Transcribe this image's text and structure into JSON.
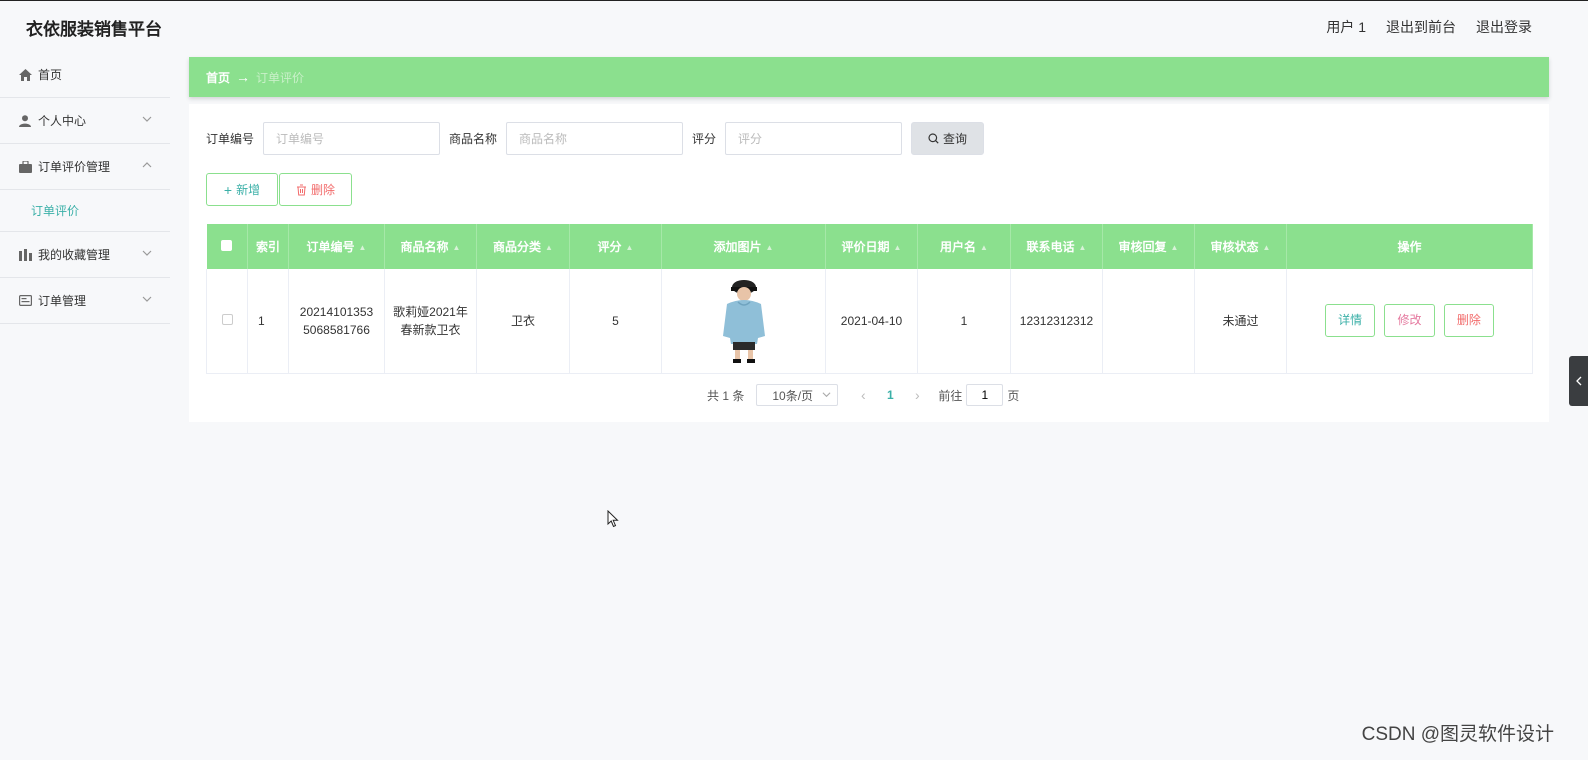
{
  "header": {
    "title": "衣依服装销售平台",
    "user": "用户 1",
    "to_front": "退出到前台",
    "logout": "退出登录"
  },
  "sidebar": {
    "items": [
      {
        "label": "首页",
        "icon": "home-icon"
      },
      {
        "label": "个人中心",
        "icon": "user-icon"
      },
      {
        "label": "订单评价管理",
        "icon": "briefcase-icon"
      },
      {
        "label": "我的收藏管理",
        "icon": "chart-icon"
      },
      {
        "label": "订单管理",
        "icon": "card-icon"
      }
    ],
    "submenu": {
      "label": "订单评价"
    }
  },
  "breadcrumb": {
    "home": "首页",
    "arrow": "→",
    "current": "订单评价"
  },
  "search": {
    "order_no_label": "订单编号",
    "order_no_placeholder": "订单编号",
    "product_label": "商品名称",
    "product_placeholder": "商品名称",
    "score_label": "评分",
    "score_placeholder": "评分",
    "query_label": "查询"
  },
  "actions": {
    "add_label": "新增",
    "delete_label": "删除"
  },
  "table": {
    "columns": [
      "索引",
      "订单编号",
      "商品名称",
      "商品分类",
      "评分",
      "添加图片",
      "评价日期",
      "用户名",
      "联系电话",
      "审核回复",
      "审核状态",
      "操作"
    ],
    "rows": [
      {
        "index": "1",
        "order_no": "202141013535068581766",
        "product": "歌莉娅2021年春新款卫衣",
        "category": "卫衣",
        "score": "5",
        "date": "2021-04-10",
        "username": "1",
        "phone": "12312312312",
        "reply": "",
        "status": "未通过"
      }
    ],
    "row_actions": {
      "detail": "详情",
      "edit": "修改",
      "delete": "删除"
    }
  },
  "pagination": {
    "total": "共 1 条",
    "page_size": "10条/页",
    "current": "1",
    "goto_label": "前往",
    "goto_value": "1",
    "page_unit": "页"
  },
  "watermark": "CSDN @图灵软件设计",
  "colors": {
    "accent": "#8be08e",
    "teal": "#3bb0a8",
    "danger": "#f26b6b"
  }
}
